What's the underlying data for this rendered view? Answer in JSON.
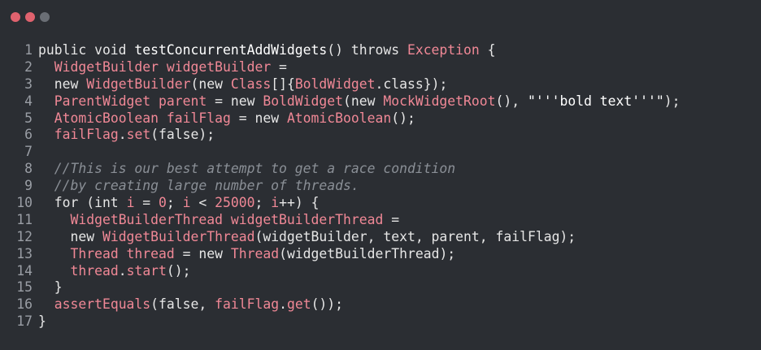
{
  "window": {
    "controls": [
      {
        "name": "close",
        "color": "#e0626e"
      },
      {
        "name": "minimize",
        "color": "#e0626e"
      },
      {
        "name": "zoom",
        "color": "#6a6e75"
      }
    ]
  },
  "colors": {
    "background": "#2b2e33",
    "keyword": "#e6e6e6",
    "type": "#f08896",
    "comment": "#8a8f96",
    "line_number": "#9a9ea5"
  },
  "code": {
    "lines": [
      {
        "num": "1",
        "tokens": [
          {
            "t": "plain",
            "v": "public void "
          },
          {
            "t": "fn",
            "v": "testConcurrentAddWidgets"
          },
          {
            "t": "plain",
            "v": "() throws "
          },
          {
            "t": "type",
            "v": "Exception"
          },
          {
            "t": "plain",
            "v": " {"
          }
        ]
      },
      {
        "num": "2",
        "tokens": [
          {
            "t": "plain",
            "v": "  "
          },
          {
            "t": "type",
            "v": "WidgetBuilder widgetBuilder"
          },
          {
            "t": "plain",
            "v": " ="
          }
        ]
      },
      {
        "num": "3",
        "tokens": [
          {
            "t": "plain",
            "v": "  new "
          },
          {
            "t": "type",
            "v": "WidgetBuilder"
          },
          {
            "t": "plain",
            "v": "(new "
          },
          {
            "t": "type",
            "v": "Class"
          },
          {
            "t": "plain",
            "v": "[]{"
          },
          {
            "t": "type",
            "v": "BoldWidget"
          },
          {
            "t": "plain",
            "v": ".class});"
          }
        ]
      },
      {
        "num": "4",
        "tokens": [
          {
            "t": "plain",
            "v": "  "
          },
          {
            "t": "type",
            "v": "ParentWidget parent"
          },
          {
            "t": "plain",
            "v": " = new "
          },
          {
            "t": "type",
            "v": "BoldWidget"
          },
          {
            "t": "plain",
            "v": "(new "
          },
          {
            "t": "type",
            "v": "MockWidgetRoot"
          },
          {
            "t": "plain",
            "v": "(), "
          },
          {
            "t": "str",
            "v": "\"'''bold text'''\""
          },
          {
            "t": "plain",
            "v": ");"
          }
        ]
      },
      {
        "num": "5",
        "tokens": [
          {
            "t": "plain",
            "v": "  "
          },
          {
            "t": "type",
            "v": "AtomicBoolean failFlag"
          },
          {
            "t": "plain",
            "v": " = new "
          },
          {
            "t": "type",
            "v": "AtomicBoolean"
          },
          {
            "t": "plain",
            "v": "();"
          }
        ]
      },
      {
        "num": "6",
        "tokens": [
          {
            "t": "plain",
            "v": "  "
          },
          {
            "t": "type",
            "v": "failFlag"
          },
          {
            "t": "plain",
            "v": "."
          },
          {
            "t": "type",
            "v": "set"
          },
          {
            "t": "plain",
            "v": "(false);"
          }
        ]
      },
      {
        "num": "7",
        "tokens": []
      },
      {
        "num": "8",
        "tokens": [
          {
            "t": "plain",
            "v": "  "
          },
          {
            "t": "comment",
            "v": "//This is our best attempt to get a race condition"
          }
        ]
      },
      {
        "num": "9",
        "tokens": [
          {
            "t": "plain",
            "v": "  "
          },
          {
            "t": "comment",
            "v": "//by creating large number of threads."
          }
        ]
      },
      {
        "num": "10",
        "tokens": [
          {
            "t": "plain",
            "v": "  for (int "
          },
          {
            "t": "type",
            "v": "i"
          },
          {
            "t": "plain",
            "v": " = "
          },
          {
            "t": "num",
            "v": "0"
          },
          {
            "t": "plain",
            "v": "; "
          },
          {
            "t": "type",
            "v": "i"
          },
          {
            "t": "plain",
            "v": " < "
          },
          {
            "t": "num",
            "v": "25000"
          },
          {
            "t": "plain",
            "v": "; "
          },
          {
            "t": "type",
            "v": "i"
          },
          {
            "t": "plain",
            "v": "++) {"
          }
        ]
      },
      {
        "num": "11",
        "tokens": [
          {
            "t": "plain",
            "v": "    "
          },
          {
            "t": "type",
            "v": "WidgetBuilderThread widgetBuilderThread"
          },
          {
            "t": "plain",
            "v": " ="
          }
        ]
      },
      {
        "num": "12",
        "tokens": [
          {
            "t": "plain",
            "v": "    new "
          },
          {
            "t": "type",
            "v": "WidgetBuilderThread"
          },
          {
            "t": "plain",
            "v": "(widgetBuilder, text, parent, failFlag);"
          }
        ]
      },
      {
        "num": "13",
        "tokens": [
          {
            "t": "plain",
            "v": "    "
          },
          {
            "t": "type",
            "v": "Thread thread"
          },
          {
            "t": "plain",
            "v": " = new "
          },
          {
            "t": "type",
            "v": "Thread"
          },
          {
            "t": "plain",
            "v": "(widgetBuilderThread);"
          }
        ]
      },
      {
        "num": "14",
        "tokens": [
          {
            "t": "plain",
            "v": "    "
          },
          {
            "t": "type",
            "v": "thread"
          },
          {
            "t": "plain",
            "v": "."
          },
          {
            "t": "type",
            "v": "start"
          },
          {
            "t": "plain",
            "v": "();"
          }
        ]
      },
      {
        "num": "15",
        "tokens": [
          {
            "t": "plain",
            "v": "  }"
          }
        ]
      },
      {
        "num": "16",
        "tokens": [
          {
            "t": "plain",
            "v": "  "
          },
          {
            "t": "type",
            "v": "assertEquals"
          },
          {
            "t": "plain",
            "v": "(false, "
          },
          {
            "t": "type",
            "v": "failFlag"
          },
          {
            "t": "plain",
            "v": "."
          },
          {
            "t": "type",
            "v": "get"
          },
          {
            "t": "plain",
            "v": "());"
          }
        ]
      },
      {
        "num": "17",
        "tokens": [
          {
            "t": "plain",
            "v": "}"
          }
        ]
      }
    ]
  }
}
